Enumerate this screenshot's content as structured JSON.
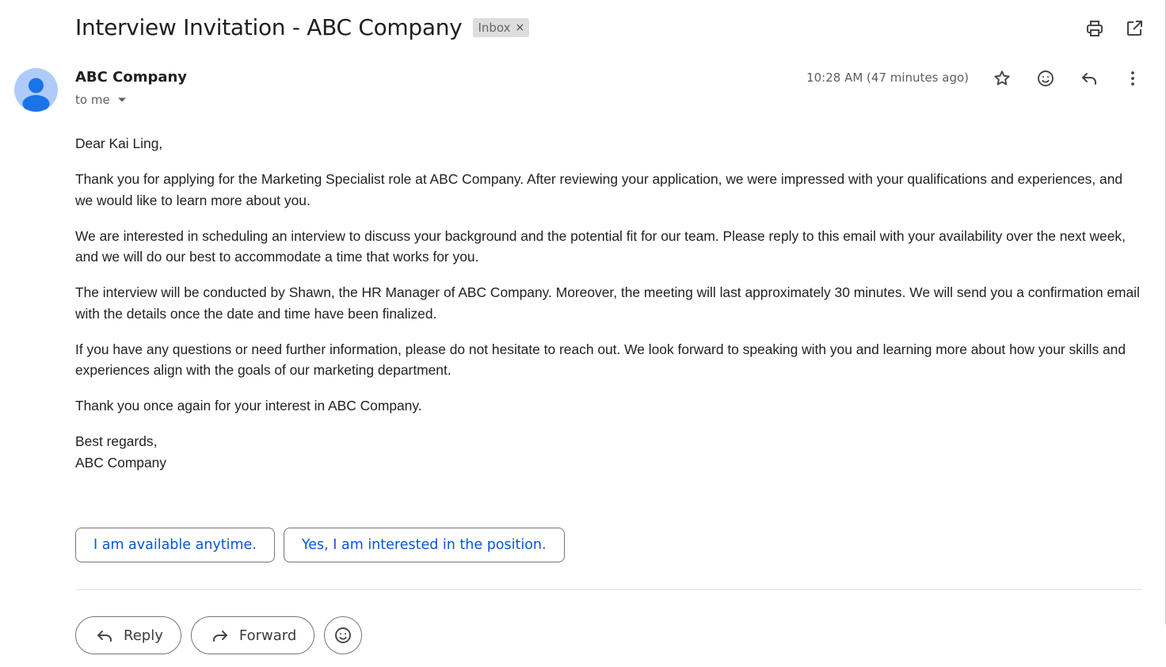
{
  "subject": "Interview Invitation - ABC Company",
  "label": {
    "text": "Inbox",
    "remove_symbol": "×"
  },
  "toolbar": {
    "icons": [
      "print-icon",
      "open-in-new-window-icon"
    ]
  },
  "sender": {
    "name": "ABC Company",
    "recipient": "to me",
    "timestamp": "10:28 AM (47 minutes ago)"
  },
  "header_actions": {
    "icons": [
      "star-icon",
      "emoji-react-icon",
      "reply-icon",
      "more-options-icon"
    ]
  },
  "body": {
    "paragraphs": [
      "Dear Kai Ling,",
      "Thank you for applying for the Marketing Specialist role at ABC Company. After reviewing your application, we were impressed with your qualifications and experiences, and we would like to learn more about you.",
      "We are interested in scheduling an interview to discuss your background and the potential fit for our team. Please reply to this email with your availability over the next week, and we will do our best to accommodate a time that works for you.",
      "The interview will be conducted by Shawn, the HR Manager of ABC Company. Moreover, the meeting will last approximately 30 minutes. We will send you a confirmation email with the details once the date and time have been finalized.",
      "If you have any questions or need further information, please do not hesitate to reach out. We look forward to speaking with you and learning more about how your skills and experiences align with the goals of our marketing department.",
      "Thank you once again for your interest in ABC Company."
    ],
    "closing": "Best regards,",
    "signature": "ABC Company"
  },
  "smart_replies": [
    "I am available anytime.",
    "Yes, I am interested in the position."
  ],
  "actions": {
    "reply_label": "Reply",
    "forward_label": "Forward"
  },
  "colors": {
    "link_blue": "#0b57d0",
    "avatar_bg": "#aecbfa",
    "avatar_fg": "#1a73e8",
    "chip_bg": "#dddddd"
  }
}
